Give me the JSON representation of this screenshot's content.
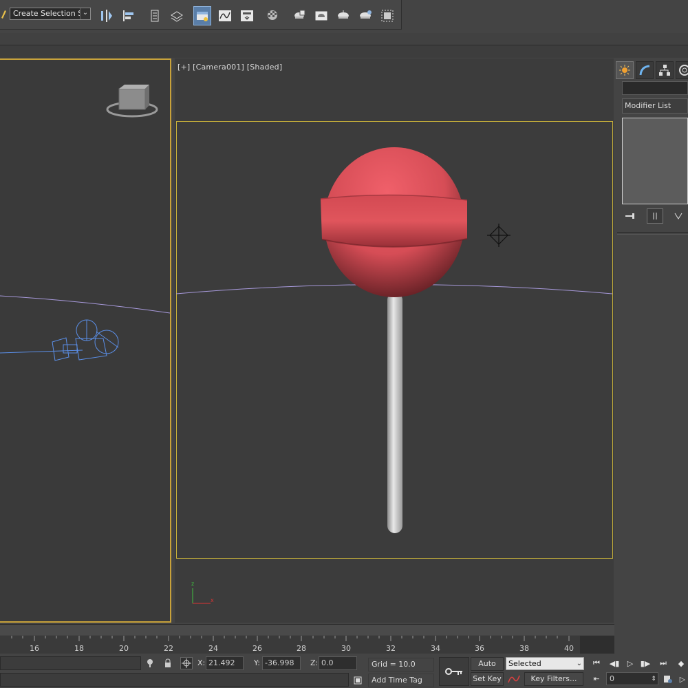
{
  "toolbar": {
    "selection_set": "Create Selection Se",
    "buttons": [
      "mirror-icon",
      "align-icon",
      "layer-manager-icon",
      "scene-explorer-icon",
      "toggle-ribbon-icon",
      "curve-editor-icon",
      "schematic-view-icon",
      "material-editor-icon",
      "render-setup-icon",
      "rendered-frame-icon",
      "render-production-icon",
      "render-iterative-icon",
      "render-activeshade-icon",
      "render-to-texture-icon"
    ],
    "active_accent": "#5a7ea8"
  },
  "viewport_right": {
    "label": "[+] [Camera001] [Shaded]",
    "safe_frame_color": "#c9b23a",
    "lollipop_color": "#e0555c",
    "stick_color": "#d8d8d8"
  },
  "viewport_left": {
    "border_color": "#c8a23a"
  },
  "command_panel": {
    "modifier_list": "Modifier List",
    "tabs": [
      "create-icon",
      "modify-icon",
      "hierarchy-icon",
      "motion-icon"
    ]
  },
  "timeline": {
    "ticks": [
      "16",
      "18",
      "20",
      "22",
      "24",
      "26",
      "28",
      "30",
      "32",
      "34",
      "36",
      "38",
      "40"
    ]
  },
  "status": {
    "x_label": "X:",
    "x_value": "21.492",
    "y_label": "Y:",
    "y_value": "-36.998",
    "z_label": "Z:",
    "z_value": "0.0",
    "grid": "Grid = 10.0",
    "add_time_tag": "Add Time Tag",
    "auto_key": "Auto Key",
    "set_key": "Set Key",
    "selected": "Selected",
    "key_filters": "Key Filters...",
    "frame": "0"
  }
}
